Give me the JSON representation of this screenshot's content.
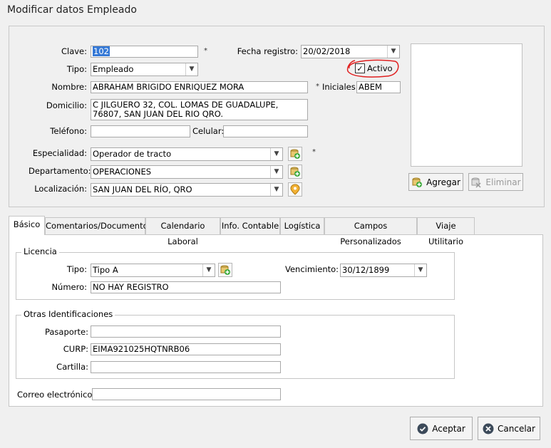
{
  "window": {
    "title": "Modificar datos Empleado"
  },
  "header": {
    "clave_label": "Clave:",
    "clave_value": "102",
    "fecha_label": "Fecha registro:",
    "fecha_value": "20/02/2018",
    "tipo_label": "Tipo:",
    "tipo_value": "Empleado",
    "activo_label": "Activo",
    "nombre_label": "Nombre:",
    "nombre_value": "ABRAHAM BRIGIDO ENRIQUEZ MORA",
    "iniciales_label": "Iniciales:",
    "iniciales_value": "ABEM",
    "domicilio_label": "Domicilio:",
    "domicilio_value": "C JILGUERO 32, COL. LOMAS DE GUADALUPE, 76807, SAN JUAN DEL RIO QRO.",
    "telefono_label": "Teléfono:",
    "telefono_value": "",
    "celular_label": "Celular:",
    "celular_value": "",
    "especialidad_label": "Especialidad:",
    "especialidad_value": "Operador de tracto",
    "departamento_label": "Departamento:",
    "departamento_value": "OPERACIONES",
    "localizacion_label": "Localización:",
    "localizacion_value": "SAN JUAN DEL RÍO, QRO",
    "required_mark": "*",
    "agregar_label": "Agregar",
    "eliminar_label": "Eliminar"
  },
  "tabs": [
    {
      "label": "Básico"
    },
    {
      "label": "Comentarios/Documentos"
    },
    {
      "label": "Calendario Laboral"
    },
    {
      "label": "Info. Contable"
    },
    {
      "label": "Logística"
    },
    {
      "label": "Campos Personalizados"
    },
    {
      "label": "Viaje Utilitario"
    }
  ],
  "licencia": {
    "title": "Licencia",
    "tipo_label": "Tipo:",
    "tipo_value": "Tipo A",
    "vencimiento_label": "Vencimiento:",
    "vencimiento_value": "30/12/1899",
    "numero_label": "Número:",
    "numero_value": "NO HAY REGISTRO"
  },
  "otras": {
    "title": "Otras Identificaciones",
    "pasaporte_label": "Pasaporte:",
    "pasaporte_value": "",
    "curp_label": "CURP:",
    "curp_value": "EIMA921025HQTNRB06",
    "cartilla_label": "Cartilla:",
    "cartilla_value": ""
  },
  "correo": {
    "label": "Correo electrónico",
    "value": ""
  },
  "footer": {
    "aceptar_label": "Aceptar",
    "cancelar_label": "Cancelar"
  },
  "colors": {
    "selection": "#3478d6",
    "annotation": "#e02020",
    "accept_icon": "#3c4a5a"
  }
}
